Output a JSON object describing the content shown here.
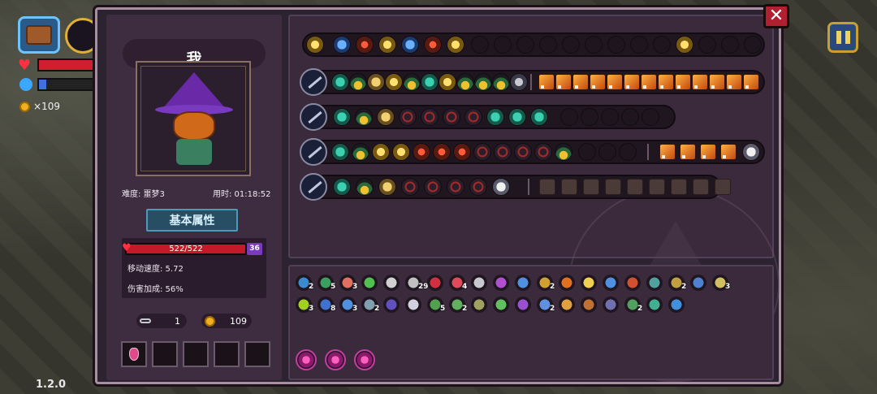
{
  "hud": {
    "coins": "×109",
    "version": "1.2.0"
  },
  "character": {
    "name": "我",
    "difficulty": "难度: 噩梦3",
    "time": "用时: 01:18:52",
    "stats_button": "基本属性",
    "hp": "522/522",
    "shield": "36",
    "move_speed": "移动速度: 5.72",
    "damage_bonus": "伤害加成: 56%",
    "keys": "1",
    "gold": "109"
  },
  "inventory": {
    "counts": [
      "2",
      "5",
      "3",
      "29",
      "4",
      "2",
      "2",
      "3",
      "3",
      "8",
      "3",
      "2",
      "5",
      "2",
      "2",
      "2"
    ]
  },
  "colors": {
    "modal_bg": "#2c2230",
    "panel_bg": "#3a2a3c",
    "hp": "#c21a28",
    "accent_gold": "#e0b030",
    "close": "#b02030"
  }
}
